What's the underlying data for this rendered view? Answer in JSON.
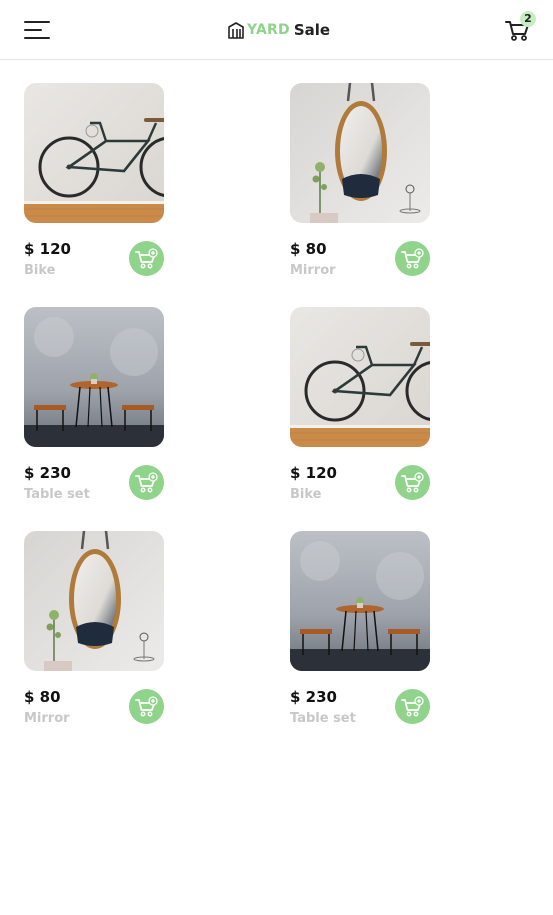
{
  "header": {
    "menu_icon": "hamburger-menu-icon",
    "brand_prefix": "YARD",
    "brand_suffix": "Sale",
    "cart_icon": "cart-icon",
    "cart_count": "2"
  },
  "colors": {
    "accent": "#8fd48a",
    "badge": "#c7ecc2",
    "muted_text": "#c8c8c8"
  },
  "products": [
    {
      "price": "$ 120",
      "name": "Bike",
      "image": "bike"
    },
    {
      "price": "$ 80",
      "name": "Mirror",
      "image": "mirror"
    },
    {
      "price": "$ 230",
      "name": "Table set",
      "image": "table-set"
    },
    {
      "price": "$ 120",
      "name": "Bike",
      "image": "bike"
    },
    {
      "price": "$ 80",
      "name": "Mirror",
      "image": "mirror"
    },
    {
      "price": "$ 230",
      "name": "Table set",
      "image": "table-set"
    }
  ]
}
